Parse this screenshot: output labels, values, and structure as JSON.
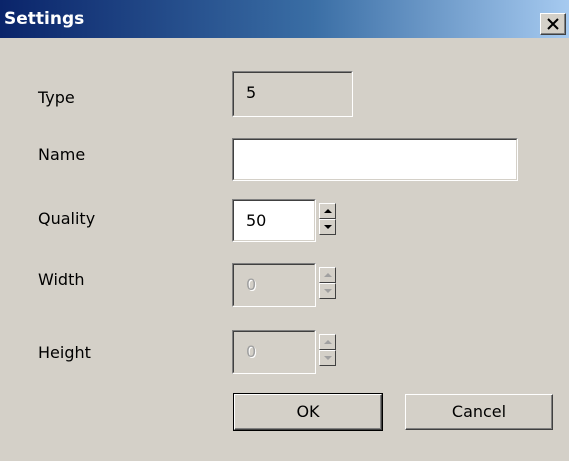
{
  "window": {
    "title": "Settings"
  },
  "fields": {
    "type": {
      "label": "Type",
      "value": "5"
    },
    "name": {
      "label": "Name",
      "value": ""
    },
    "quality": {
      "label": "Quality",
      "value": "50"
    },
    "width": {
      "label": "Width",
      "value": "0"
    },
    "height": {
      "label": "Height",
      "value": "0"
    }
  },
  "buttons": {
    "ok": "OK",
    "cancel": "Cancel"
  },
  "colors": {
    "dialog_bg": "#d4d0c8",
    "titlebar_start": "#0a246a",
    "titlebar_end": "#a6caf0",
    "disabled_text": "#a0a0a0"
  }
}
